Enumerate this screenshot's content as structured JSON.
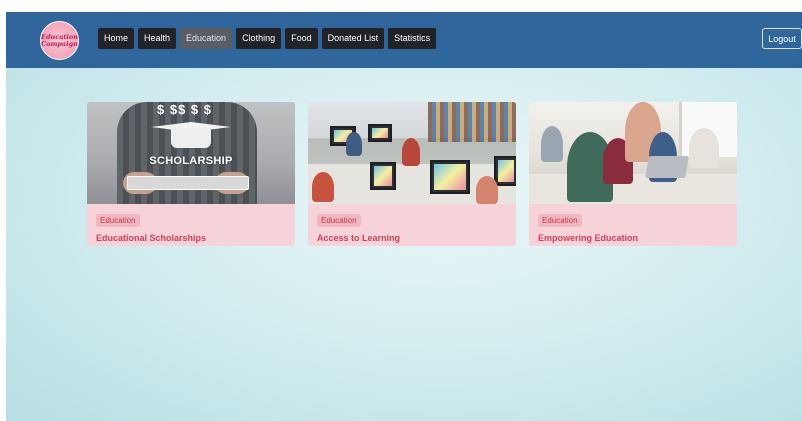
{
  "navbar": {
    "logo_text": [
      "Education",
      "Campaign"
    ],
    "links": [
      {
        "label": "Home",
        "active": false
      },
      {
        "label": "Health",
        "active": false
      },
      {
        "label": "Education",
        "active": true
      },
      {
        "label": "Clothing",
        "active": false
      },
      {
        "label": "Food",
        "active": false
      },
      {
        "label": "Donated List",
        "active": false
      },
      {
        "label": "Statistics",
        "active": false
      }
    ],
    "logout_label": "Logout"
  },
  "cards": [
    {
      "tag": "Education",
      "title": "Educational Scholarships",
      "image_icon": "scholarship-image",
      "image_text": "SCHOLARSHIP",
      "image_symbols": "$ $$ $ $"
    },
    {
      "tag": "Education",
      "title": "Access to Learning",
      "image_icon": "computer-lab-image"
    },
    {
      "tag": "Education",
      "title": "Empowering Education",
      "image_icon": "kids-laptop-image"
    }
  ],
  "colors": {
    "navbar": "#2f669b",
    "nav_button": "#222326",
    "nav_button_active": "#5a5e63",
    "card_background": "#f5d3d8",
    "tag_background": "#f0b7c0",
    "accent_text": "#d6405a",
    "page_background": "#d8eff1"
  }
}
